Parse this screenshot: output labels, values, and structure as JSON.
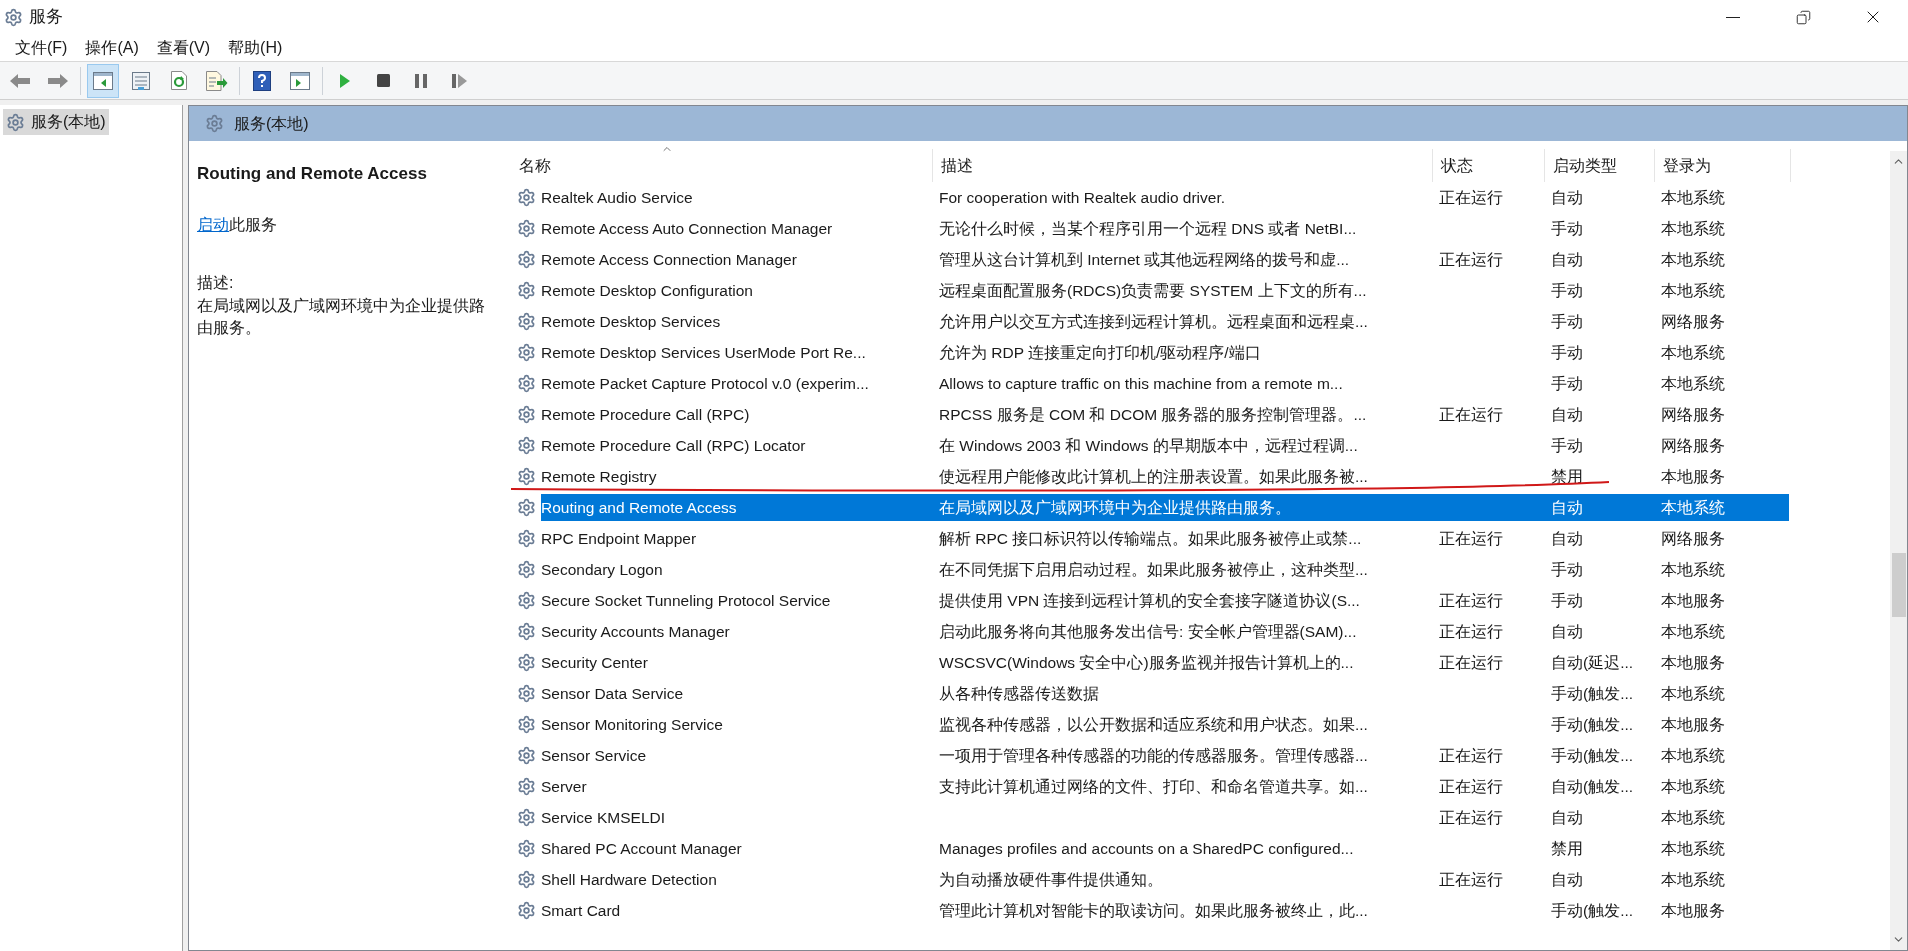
{
  "window": {
    "title": "服务"
  },
  "menu": [
    "文件(F)",
    "操作(A)",
    "查看(V)",
    "帮助(H)"
  ],
  "toolbar": [
    [
      {
        "kind": "back",
        "pressed": false
      },
      {
        "kind": "forward",
        "pressed": false
      }
    ],
    [
      {
        "kind": "tree",
        "pressed": true
      },
      {
        "kind": "properties",
        "pressed": false
      },
      {
        "kind": "refresh",
        "pressed": false
      },
      {
        "kind": "export",
        "pressed": false
      }
    ],
    [
      {
        "kind": "help",
        "pressed": false
      },
      {
        "kind": "actionpane",
        "pressed": false
      }
    ],
    [
      {
        "kind": "start",
        "pressed": false
      },
      {
        "kind": "stop",
        "pressed": false
      },
      {
        "kind": "pause",
        "pressed": false
      },
      {
        "kind": "resume",
        "pressed": false
      }
    ]
  ],
  "tree": [
    {
      "label": "服务(本地)",
      "selected": true
    }
  ],
  "pane_header": "服务(本地)",
  "details": {
    "title": "Routing and Remote Access",
    "action_link": "启动",
    "action_text": "此服务",
    "description_label": "描述:",
    "description": "在局域网以及广域网环境中为企业提供路由服务。"
  },
  "table": {
    "columns": [
      {
        "label": "名称",
        "sorted": true
      },
      {
        "label": "描述",
        "sorted": false
      },
      {
        "label": "状态",
        "sorted": false
      },
      {
        "label": "启动类型",
        "sorted": false
      },
      {
        "label": "登录为",
        "sorted": false
      }
    ],
    "rows": [
      {
        "name": "Realtek Audio Service",
        "description": "For cooperation with Realtek audio driver.",
        "status": "正在运行",
        "startup": "自动",
        "logon": "本地系统",
        "selected": false
      },
      {
        "name": "Remote Access Auto Connection Manager",
        "description": "无论什么时候，当某个程序引用一个远程 DNS 或者 NetBI...",
        "startup": "手动",
        "logon": "本地系统",
        "selected": false
      },
      {
        "name": "Remote Access Connection Manager",
        "description": "管理从这台计算机到 Internet 或其他远程网络的拨号和虚...",
        "status": "正在运行",
        "startup": "自动",
        "logon": "本地系统",
        "selected": false
      },
      {
        "name": "Remote Desktop Configuration",
        "description": "远程桌面配置服务(RDCS)负责需要 SYSTEM 上下文的所有...",
        "startup": "手动",
        "logon": "本地系统",
        "selected": false
      },
      {
        "name": "Remote Desktop Services",
        "description": "允许用户以交互方式连接到远程计算机。远程桌面和远程桌...",
        "startup": "手动",
        "logon": "网络服务",
        "selected": false
      },
      {
        "name": "Remote Desktop Services UserMode Port Re...",
        "description": "允许为 RDP 连接重定向打印机/驱动程序/端口",
        "startup": "手动",
        "logon": "本地系统",
        "selected": false
      },
      {
        "name": "Remote Packet Capture Protocol v.0 (experim...",
        "description": "Allows to capture traffic on this machine from a remote m...",
        "startup": "手动",
        "logon": "本地系统",
        "selected": false
      },
      {
        "name": "Remote Procedure Call (RPC)",
        "description": "RPCSS 服务是 COM 和 DCOM 服务器的服务控制管理器。...",
        "status": "正在运行",
        "startup": "自动",
        "logon": "网络服务",
        "selected": false
      },
      {
        "name": "Remote Procedure Call (RPC) Locator",
        "description": "在 Windows 2003 和 Windows 的早期版本中，远程过程调...",
        "startup": "手动",
        "logon": "网络服务",
        "selected": false
      },
      {
        "name": "Remote Registry",
        "description": "使远程用户能修改此计算机上的注册表设置。如果此服务被...",
        "startup": "禁用",
        "logon": "本地服务",
        "selected": false
      },
      {
        "name": "Routing and Remote Access",
        "description": "在局域网以及广域网环境中为企业提供路由服务。",
        "startup": "自动",
        "logon": "本地系统",
        "selected": true
      },
      {
        "name": "RPC Endpoint Mapper",
        "description": "解析 RPC 接口标识符以传输端点。如果此服务被停止或禁...",
        "status": "正在运行",
        "startup": "自动",
        "logon": "网络服务",
        "selected": false
      },
      {
        "name": "Secondary Logon",
        "description": "在不同凭据下启用启动过程。如果此服务被停止，这种类型...",
        "startup": "手动",
        "logon": "本地系统",
        "selected": false
      },
      {
        "name": "Secure Socket Tunneling Protocol Service",
        "description": "提供使用 VPN 连接到远程计算机的安全套接字隧道协议(S...",
        "status": "正在运行",
        "startup": "手动",
        "logon": "本地服务",
        "selected": false
      },
      {
        "name": "Security Accounts Manager",
        "description": "启动此服务将向其他服务发出信号: 安全帐户管理器(SAM)...",
        "status": "正在运行",
        "startup": "自动",
        "logon": "本地系统",
        "selected": false
      },
      {
        "name": "Security Center",
        "description": "WSCSVC(Windows 安全中心)服务监视并报告计算机上的...",
        "status": "正在运行",
        "startup": "自动(延迟...",
        "logon": "本地服务",
        "selected": false
      },
      {
        "name": "Sensor Data Service",
        "description": "从各种传感器传送数据",
        "startup": "手动(触发...",
        "logon": "本地系统",
        "selected": false
      },
      {
        "name": "Sensor Monitoring Service",
        "description": "监视各种传感器，以公开数据和适应系统和用户状态。如果...",
        "startup": "手动(触发...",
        "logon": "本地服务",
        "selected": false
      },
      {
        "name": "Sensor Service",
        "description": "一项用于管理各种传感器的功能的传感器服务。管理传感器...",
        "status": "正在运行",
        "startup": "手动(触发...",
        "logon": "本地系统",
        "selected": false
      },
      {
        "name": "Server",
        "description": "支持此计算机通过网络的文件、打印、和命名管道共享。如...",
        "status": "正在运行",
        "startup": "自动(触发...",
        "logon": "本地系统",
        "selected": false
      },
      {
        "name": "Service KMSELDI",
        "status": "正在运行",
        "startup": "自动",
        "logon": "本地系统",
        "selected": false
      },
      {
        "name": "Shared PC Account Manager",
        "description": "Manages profiles and accounts on a SharedPC configured...",
        "startup": "禁用",
        "logon": "本地系统",
        "selected": false
      },
      {
        "name": "Shell Hardware Detection",
        "description": "为自动播放硬件事件提供通知。",
        "status": "正在运行",
        "startup": "自动",
        "logon": "本地系统",
        "selected": false
      },
      {
        "name": "Smart Card",
        "description": "管理此计算机对智能卡的取读访问。如果此服务被终止，此...",
        "startup": "手动(触发...",
        "logon": "本地服务",
        "selected": false
      }
    ]
  }
}
